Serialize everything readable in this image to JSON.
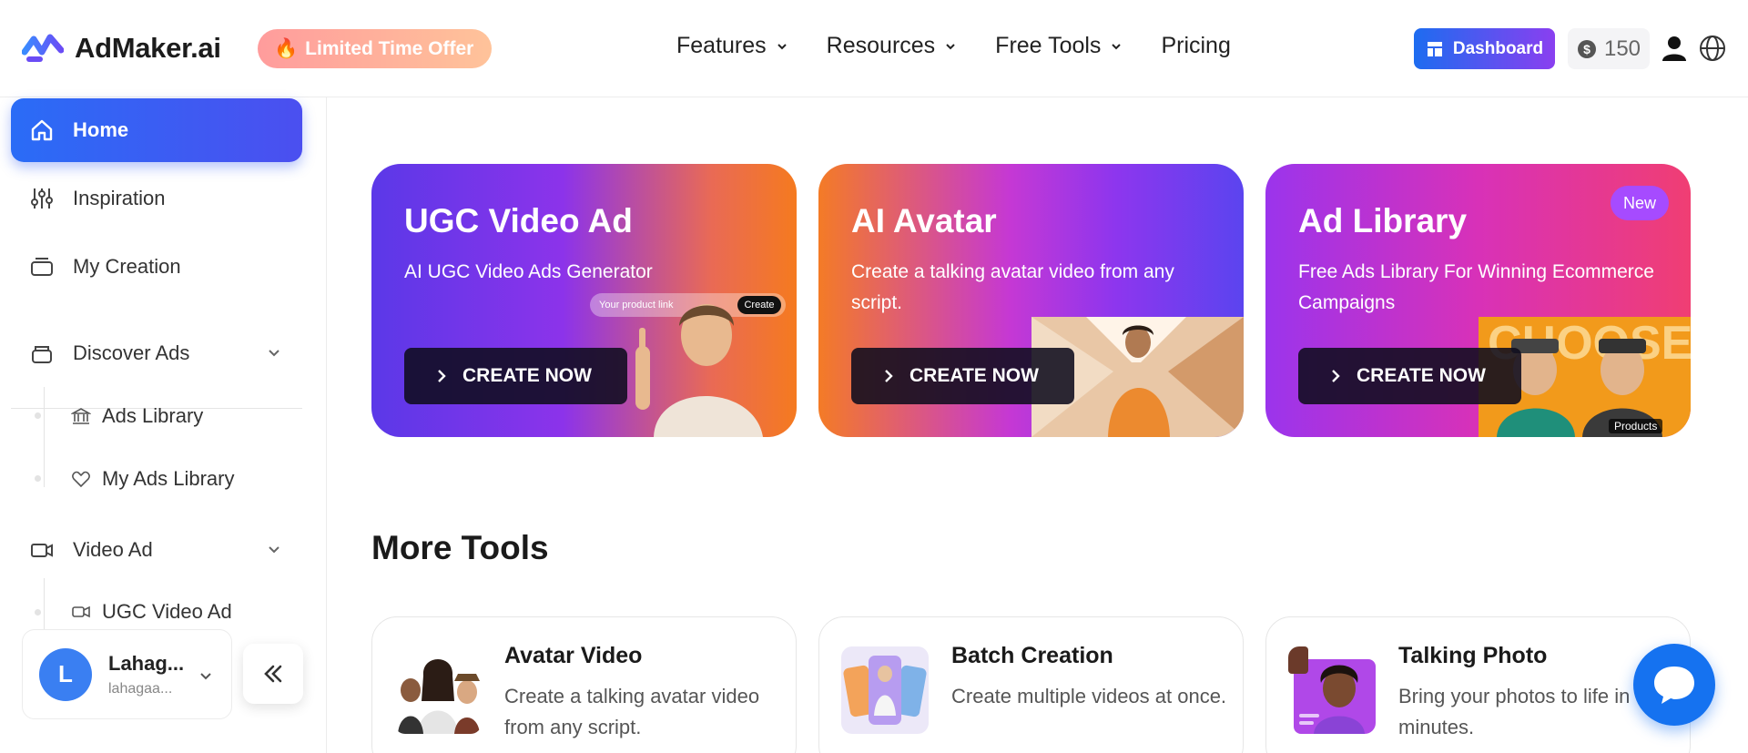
{
  "header": {
    "brand": "AdMaker.ai",
    "offer": "Limited Time Offer",
    "nav": [
      {
        "label": "Features"
      },
      {
        "label": "Resources"
      },
      {
        "label": "Free Tools"
      },
      {
        "label": "Pricing"
      }
    ],
    "dashboard_label": "Dashboard",
    "credits": "150"
  },
  "sidebar": {
    "items": [
      {
        "label": "Home",
        "icon": "home-icon"
      },
      {
        "label": "Inspiration",
        "icon": "sliders-icon"
      },
      {
        "label": "My Creation",
        "icon": "folder-icon"
      }
    ],
    "groups": [
      {
        "label": "Discover Ads",
        "icon": "layers-icon",
        "children": [
          {
            "label": "Ads Library",
            "icon": "bank-icon"
          },
          {
            "label": "My Ads Library",
            "icon": "heart-icon"
          }
        ]
      },
      {
        "label": "Video Ad",
        "icon": "video-icon",
        "children": [
          {
            "label": "UGC Video Ad",
            "icon": "video-icon"
          }
        ]
      }
    ],
    "profile": {
      "initial": "L",
      "name": "Lahag...",
      "email": "lahagaa..."
    }
  },
  "cards": [
    {
      "title": "UGC Video Ad",
      "subtitle": "AI UGC Video Ads Generator",
      "button": "CREATE NOW",
      "mock_input": "Your product link",
      "mock_button": "Create"
    },
    {
      "title": "AI Avatar",
      "subtitle": "Create a talking avatar video from any script.",
      "button": "CREATE NOW"
    },
    {
      "title": "Ad Library",
      "subtitle": "Free Ads Library For Winning Ecommerce Campaigns",
      "button": "CREATE NOW",
      "badge": "New",
      "image_caption": "Products"
    }
  ],
  "more_tools": {
    "title": "More Tools",
    "items": [
      {
        "title": "Avatar Video",
        "desc": "Create a talking avatar video from any script."
      },
      {
        "title": "Batch Creation",
        "desc": "Create multiple videos at once."
      },
      {
        "title": "Talking Photo",
        "desc": "Bring your photos to life in minutes."
      }
    ]
  },
  "colors": {
    "primary": "#2a6cf6",
    "accent": "#8a3ff0",
    "chat": "#1572f0"
  }
}
